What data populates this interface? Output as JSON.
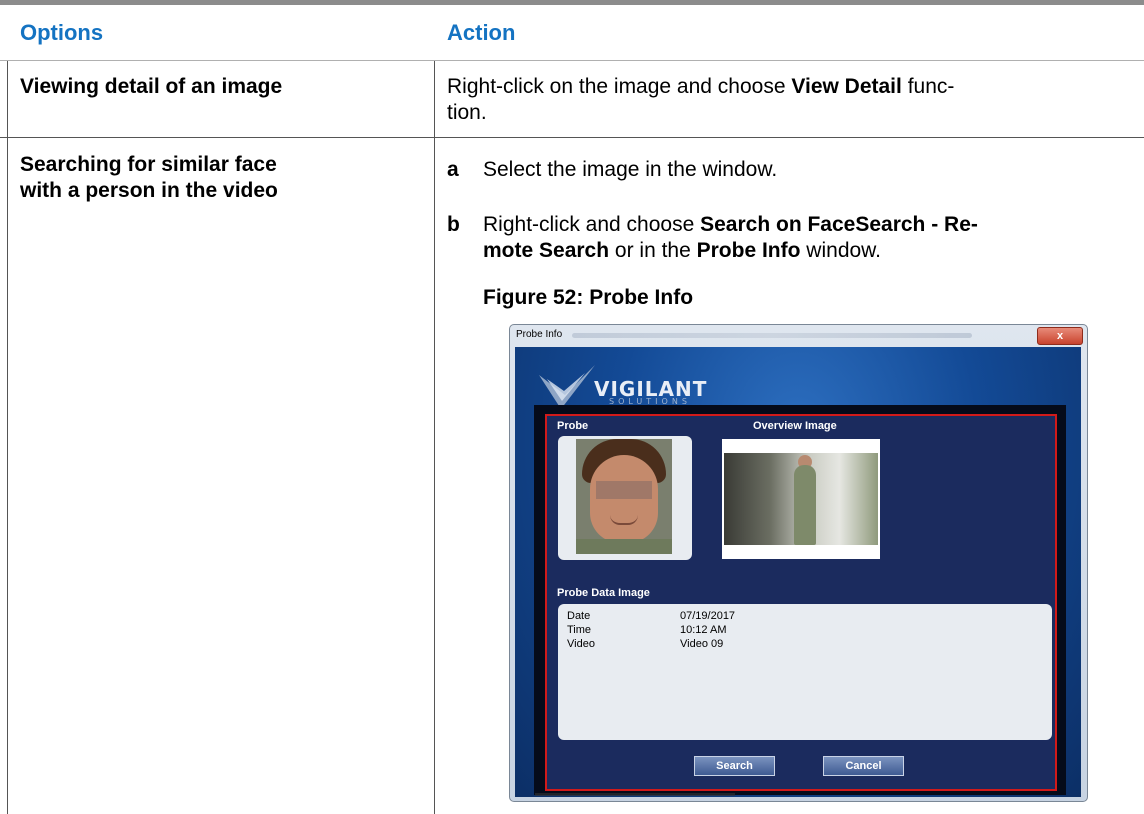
{
  "table": {
    "headers": [
      "Options",
      "Action"
    ],
    "rows": [
      {
        "option": "Viewing detail of an image",
        "action": {
          "line1_pre": "Right-click on the image and choose ",
          "line1_bold": "View Detail",
          "line1_post": " func-",
          "line2": "tion."
        }
      },
      {
        "option_line1": "Searching for similar face",
        "option_line2": "with a person in the video",
        "steps": [
          {
            "letter": "a",
            "text": "Select the image in the window."
          },
          {
            "letter": "b",
            "line1_pre": "Right-click and choose ",
            "line1_bold": "Search on FaceSearch - Re-",
            "line2_bold": "mote Search",
            "line2_mid": " or in the ",
            "line2_bold2": "Probe Info",
            "line2_post": " window."
          }
        ],
        "figure_caption": "Figure 52: Probe Info"
      }
    ]
  },
  "probe_window": {
    "title": "Probe Info",
    "close_glyph": "x",
    "logo_text": "VIGILANT",
    "logo_sub": "SOLUTIONS",
    "probe_label": "Probe",
    "overview_label": "Overview Image",
    "probe_data_label": "Probe Data Image",
    "fields": [
      {
        "key": "Date",
        "value": "07/19/2017"
      },
      {
        "key": "Time",
        "value": "10:12 AM"
      },
      {
        "key": "Video",
        "value": "Video 09"
      }
    ],
    "search_button": "Search",
    "cancel_button": "Cancel",
    "colors": {
      "frame_red": "#d11a1a",
      "panel_blue": "#1b2b5e",
      "header_blue": "#1473c2"
    }
  }
}
